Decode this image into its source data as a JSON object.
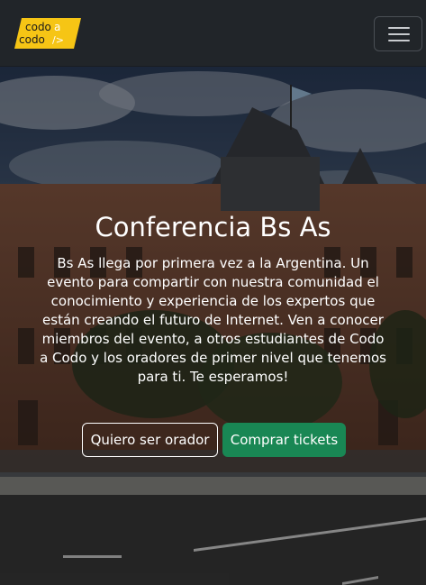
{
  "navbar": {
    "logo_line1": "codo",
    "logo_a": "a",
    "logo_line2": "codo",
    "logo_mark": "/>",
    "toggler_icon": "hamburger-menu-icon"
  },
  "hero": {
    "title": "Conferencia Bs As",
    "description": "Bs As llega por primera vez a la Argentina. Un evento para compartir con nuestra comunidad el conocimiento y experiencia de los expertos que están creando el futuro de Internet. Ven a conocer miembros del evento, a otros estudiantes de Codo a Codo y los oradores de primer nivel que tenemos para ti. Te esperamos!",
    "btn_speaker": "Quiero ser orador",
    "btn_tickets": "Comprar tickets"
  },
  "colors": {
    "navbar_bg": "#212529",
    "logo_yellow": "#f6c515",
    "success": "#198754"
  }
}
